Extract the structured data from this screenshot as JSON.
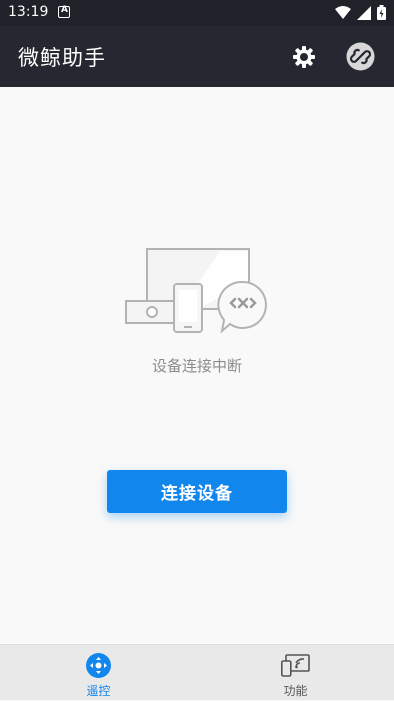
{
  "status_bar": {
    "time": "13:19",
    "notification_letter": "A",
    "icons": [
      "wifi-icon",
      "signal-icon",
      "battery-icon"
    ]
  },
  "app_bar": {
    "title": "微鲸助手",
    "settings_icon": "gear-icon",
    "link_icon": "link-icon"
  },
  "main": {
    "illustration_icon": "device-disconnected-icon",
    "status_text": "设备连接中断",
    "connect_button_label": "连接设备"
  },
  "bottom_nav": {
    "tabs": [
      {
        "label": "遥控",
        "icon": "remote-icon",
        "active": true
      },
      {
        "label": "功能",
        "icon": "cast-icon",
        "active": false
      }
    ]
  },
  "colors": {
    "accent": "#1187ee",
    "app_bar_bg": "#252831",
    "status_bar_bg": "#1f2229",
    "content_bg": "#f9f9f9",
    "bottom_nav_bg": "#e9e9e9",
    "status_text": "#8c8c8c"
  }
}
